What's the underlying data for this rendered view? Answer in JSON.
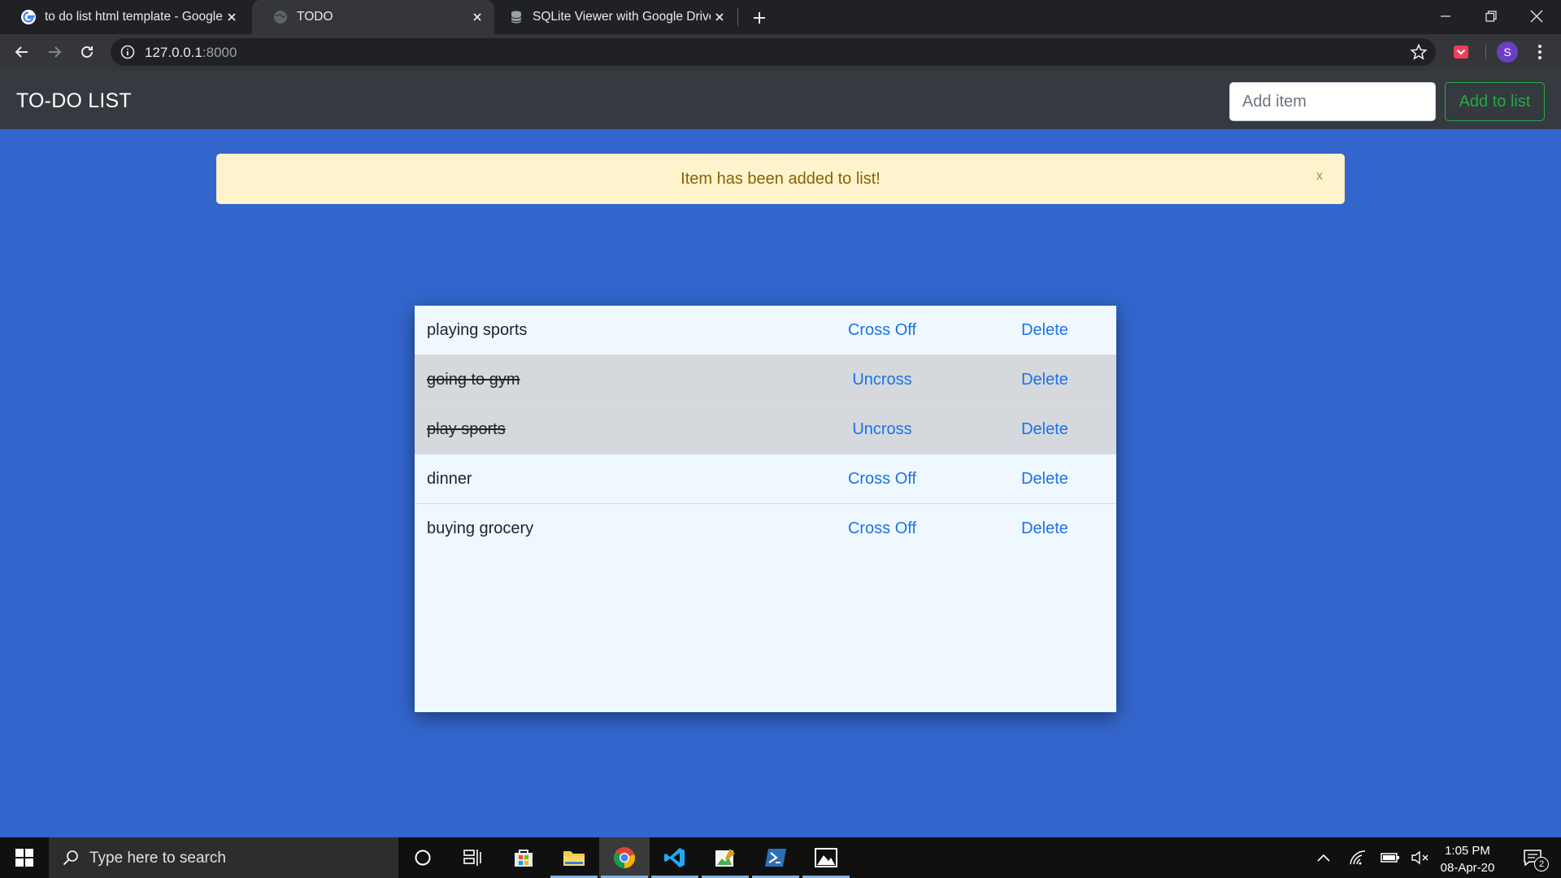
{
  "browser": {
    "tabs": [
      {
        "title": "to do list html template - Google",
        "active": false
      },
      {
        "title": "TODO",
        "active": true
      },
      {
        "title": "SQLite Viewer with Google Drive",
        "active": false
      }
    ],
    "url_host": "127.0.0.1",
    "url_port": ":8000",
    "profile_initial": "S"
  },
  "navbar": {
    "brand": "TO-DO LIST",
    "input_placeholder": "Add item",
    "add_button": "Add to list"
  },
  "alert": {
    "message": "Item has been added to list!",
    "close": "x"
  },
  "todos": [
    {
      "text": "playing sports",
      "completed": false,
      "toggle_label": "Cross Off",
      "delete_label": "Delete"
    },
    {
      "text": "going to gym",
      "completed": true,
      "toggle_label": "Uncross",
      "delete_label": "Delete"
    },
    {
      "text": "play sports",
      "completed": true,
      "toggle_label": "Uncross",
      "delete_label": "Delete"
    },
    {
      "text": "dinner",
      "completed": false,
      "toggle_label": "Cross Off",
      "delete_label": "Delete"
    },
    {
      "text": "buying grocery",
      "completed": false,
      "toggle_label": "Cross Off",
      "delete_label": "Delete"
    }
  ],
  "taskbar": {
    "search_placeholder": "Type here to search",
    "time": "1:05 PM",
    "date": "08-Apr-20",
    "notification_count": "2"
  },
  "colors": {
    "page_background": "#3366cc",
    "navbar": "#343a40",
    "alert_background": "#fff3cd",
    "alert_text": "#856404",
    "link": "#1a73e8",
    "success": "#28a745"
  }
}
